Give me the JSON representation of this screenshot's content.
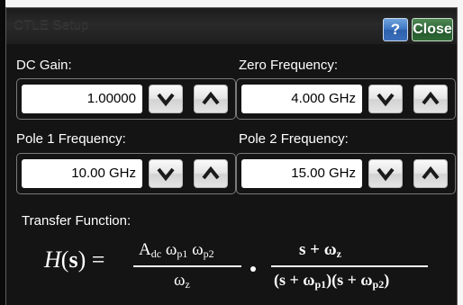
{
  "window": {
    "title": "CTLE Setup",
    "help_label": "?",
    "close_label": "Close"
  },
  "dc_gain": {
    "label": "DC Gain:",
    "value": "1.00000"
  },
  "zero_frequency": {
    "label": "Zero Frequency:",
    "value": "4.000 GHz"
  },
  "pole1_frequency": {
    "label": "Pole 1 Frequency:",
    "value": "10.00 GHz"
  },
  "pole2_frequency": {
    "label": "Pole 2 Frequency:",
    "value": "15.00 GHz"
  },
  "transfer_function": {
    "label": "Transfer Function:",
    "lhs_H": "H",
    "lhs_open": "(",
    "lhs_s": "s",
    "lhs_close": ")",
    "equals": "=",
    "num1_A": "A",
    "num1_dc": "dc",
    "omega": "ω",
    "sub_p1": "p1",
    "sub_p2": "p2",
    "sub_z": "z",
    "num2_s_plus": "s +",
    "den2_open": "(s +",
    "den2_mid": ")(s +",
    "den2_close": ")"
  },
  "icons": {
    "down": "chevron-down-icon",
    "up": "chevron-up-icon"
  },
  "colors": {
    "background": "#141414",
    "help_button": "#3e76c3",
    "close_button": "#2f6637",
    "text": "#ffffff"
  }
}
